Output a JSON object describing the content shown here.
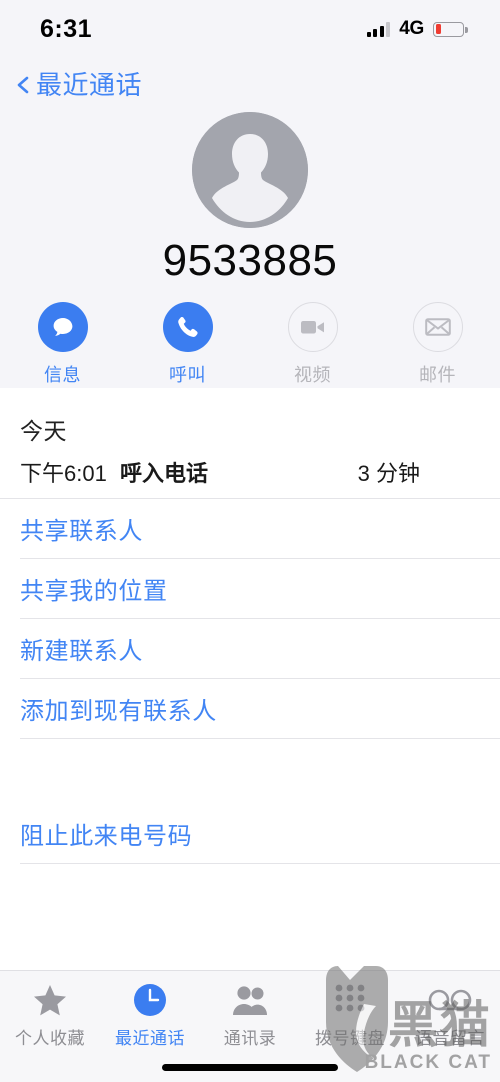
{
  "status_bar": {
    "time": "6:31",
    "network": "4G",
    "signal_icon": "signal-bars-icon",
    "battery_icon": "battery-low-icon",
    "battery_level_percent": 22,
    "battery_color": "#ef3c32"
  },
  "nav": {
    "back_label": "最近通话",
    "back_icon": "chevron-left-icon",
    "accent_color": "#4285f4"
  },
  "contact": {
    "avatar_icon": "person-placeholder-icon",
    "number": "9533885"
  },
  "actions": [
    {
      "label": "信息",
      "icon": "message-bubble-icon",
      "enabled": true
    },
    {
      "label": "呼叫",
      "icon": "phone-handset-icon",
      "enabled": true
    },
    {
      "label": "视频",
      "icon": "video-camera-icon",
      "enabled": false
    },
    {
      "label": "邮件",
      "icon": "envelope-icon",
      "enabled": false
    }
  ],
  "history": {
    "title": "今天",
    "entry": {
      "time": "下午6:01",
      "type": "呼入电话",
      "duration": "3 分钟"
    }
  },
  "list_primary": [
    {
      "label": "共享联系人"
    },
    {
      "label": "共享我的位置"
    },
    {
      "label": "新建联系人"
    },
    {
      "label": "添加到现有联系人"
    }
  ],
  "list_secondary": [
    {
      "label": "阻止此来电号码"
    }
  ],
  "tabs": [
    {
      "label": "个人收藏",
      "icon": "star-icon",
      "active": false
    },
    {
      "label": "最近通话",
      "icon": "clock-icon",
      "active": true
    },
    {
      "label": "通讯录",
      "icon": "contacts-people-icon",
      "active": false
    },
    {
      "label": "拨号键盘",
      "icon": "dial-keypad-icon",
      "active": false
    },
    {
      "label": "语音留言",
      "icon": "voicemail-icon",
      "active": false
    }
  ],
  "watermark": {
    "logo_icon": "black-cat-shield-logo",
    "title": "黑猫",
    "subtitle": "BLACK CAT"
  }
}
